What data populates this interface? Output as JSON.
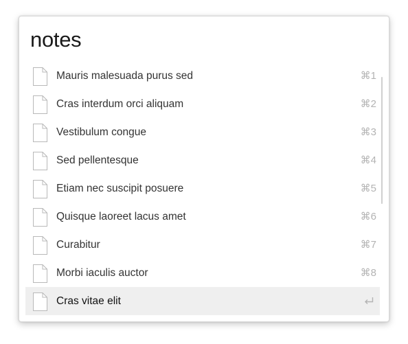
{
  "search": {
    "query": "notes"
  },
  "results": [
    {
      "title": "Mauris malesuada purus sed",
      "shortcut": "⌘1",
      "icon": "document-icon"
    },
    {
      "title": "Cras interdum orci aliquam",
      "shortcut": "⌘2",
      "icon": "document-icon"
    },
    {
      "title": "Vestibulum congue",
      "shortcut": "⌘3",
      "icon": "document-icon"
    },
    {
      "title": "Sed pellentesque",
      "shortcut": "⌘4",
      "icon": "document-icon"
    },
    {
      "title": "Etiam nec suscipit posuere",
      "shortcut": "⌘5",
      "icon": "document-icon"
    },
    {
      "title": "Quisque laoreet lacus amet",
      "shortcut": "⌘6",
      "icon": "document-icon"
    },
    {
      "title": "Curabitur",
      "shortcut": "⌘7",
      "icon": "document-icon"
    },
    {
      "title": "Morbi iaculis auctor",
      "shortcut": "⌘8",
      "icon": "document-icon"
    },
    {
      "title": "Cras vitae elit",
      "shortcut": "",
      "icon": "document-icon",
      "selected": true,
      "action_icon": "return-icon"
    }
  ],
  "colors": {
    "selected_row_bg": "#efefef",
    "shortcut_text": "#b3b3b3",
    "title_text": "#333333"
  }
}
